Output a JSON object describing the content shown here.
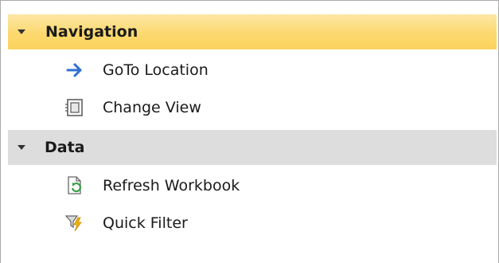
{
  "groups": [
    {
      "title": "Navigation",
      "expanded": true,
      "items": [
        {
          "label": "GoTo Location",
          "icon": "arrow-right-icon"
        },
        {
          "label": "Change View",
          "icon": "change-view-icon"
        }
      ]
    },
    {
      "title": "Data",
      "expanded": true,
      "items": [
        {
          "label": "Refresh Workbook",
          "icon": "refresh-workbook-icon"
        },
        {
          "label": "Quick Filter",
          "icon": "quick-filter-icon"
        }
      ]
    }
  ],
  "colors": {
    "selected_header": "#fcd96f",
    "group_header": "#dddddd",
    "arrow_blue": "#2e6fd1",
    "refresh_green": "#3aa04a",
    "filter_lightning": "#f0b400"
  }
}
